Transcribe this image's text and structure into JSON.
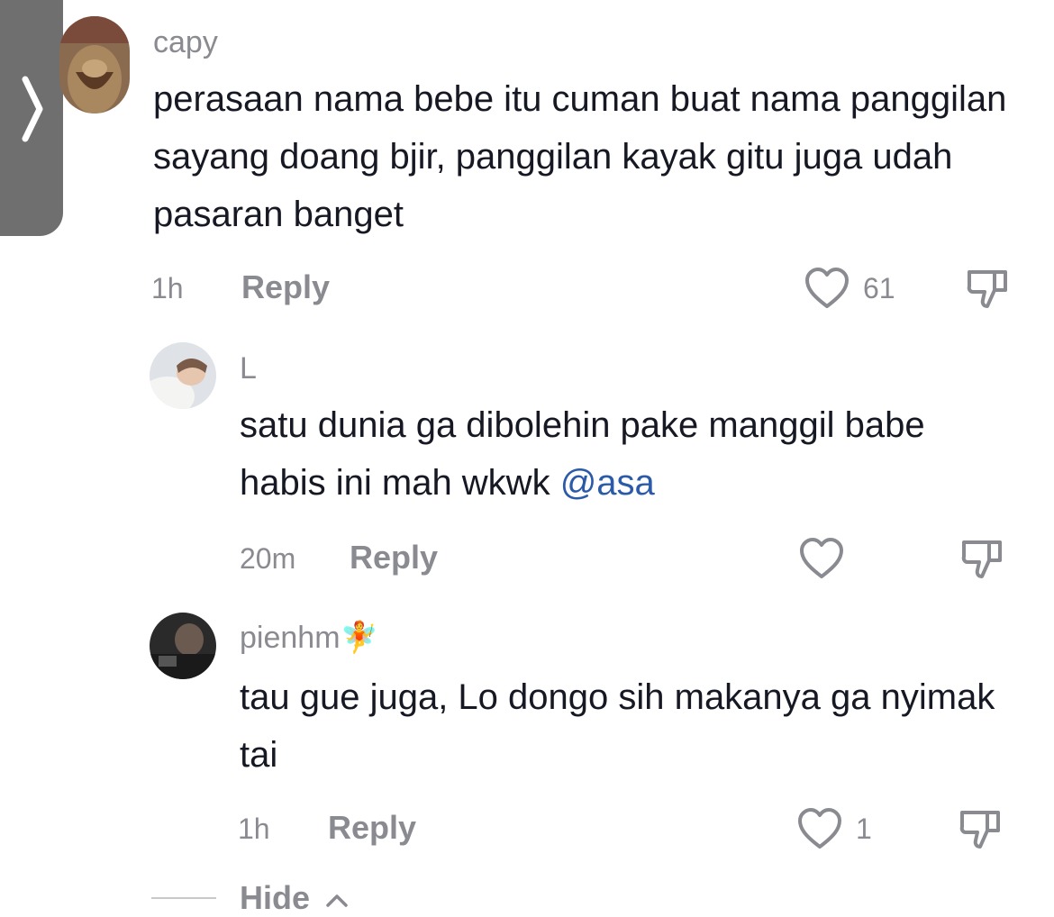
{
  "comments": [
    {
      "username": "capy",
      "text": "perasaan nama bebe itu cuman buat nama panggilan sayang doang bjir, panggilan kayak gitu juga udah pasaran banget",
      "time": "1h",
      "reply_label": "Reply",
      "likes": "61"
    }
  ],
  "replies": [
    {
      "username": "L",
      "text": "satu dunia ga dibolehin pake manggil babe habis ini mah wkwk ",
      "mention": "@asa",
      "time": "20m",
      "reply_label": "Reply",
      "likes": ""
    },
    {
      "username": "pienhm",
      "badge": "🧚",
      "text": "tau gue juga, Lo dongo sih makanya ga nyimak tai",
      "time": "1h",
      "reply_label": "Reply",
      "likes": "1"
    }
  ],
  "hide_label": "Hide",
  "icons": {
    "back": "chevron-right-icon",
    "like": "heart-outline-icon",
    "dislike": "thumbs-down-icon",
    "collapse": "chevron-up-icon"
  },
  "colors": {
    "text": "#161823",
    "secondary": "#8a8b91",
    "mention": "#2b5aa8",
    "side_tab": "#6f6f6f"
  }
}
